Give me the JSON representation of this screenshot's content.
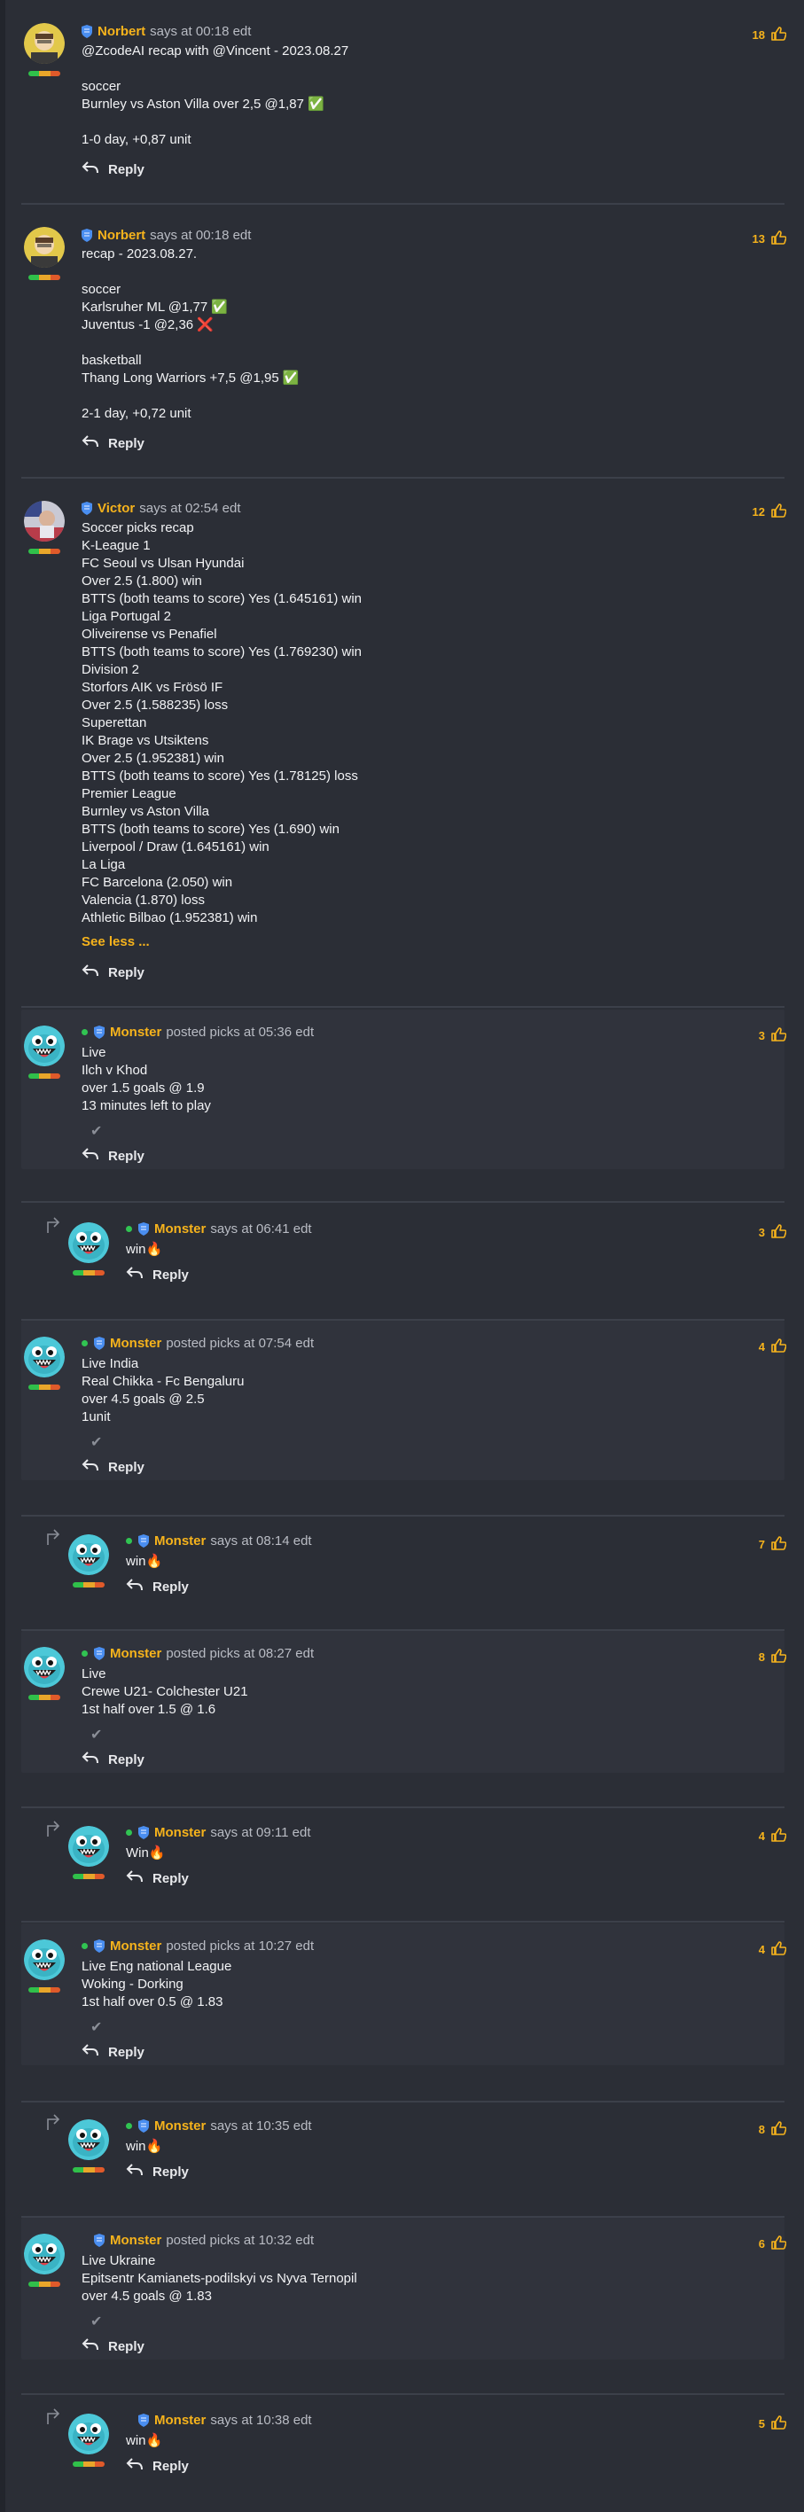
{
  "ui": {
    "says_at": "says at",
    "posted_picks_at": "posted picks at",
    "reply_label": "Reply",
    "see_less": "See less ..."
  },
  "colors": {
    "background": "#2b2e36",
    "accent": "#f6b31c",
    "online": "#31c452",
    "badge": "#4a8ef0",
    "separator": "#3c404a"
  },
  "posts": [
    {
      "author": "Norbert",
      "time": "00:18 edt",
      "likes": "18",
      "avatar": "avatar-norbert",
      "body": "@ZcodeAI recap with @Vincent - 2023.08.27\n\nsoccer\nBurnley vs Aston Villa over 2,5 @1,87 ✅\n\n1-0 day, +0,87 unit"
    },
    {
      "author": "Norbert",
      "time": "00:18 edt",
      "likes": "13",
      "avatar": "avatar-norbert",
      "body": "recap - 2023.08.27.\n\nsoccer\nKarlsruher ML @1,77 ✅\nJuventus -1 @2,36 ❌\n\nbasketball\nThang Long Warriors +7,5 @1,95 ✅\n\n2-1 day, +0,72 unit"
    },
    {
      "author": "Victor",
      "time": "02:54 edt",
      "likes": "12",
      "avatar": "avatar-victor",
      "body": "Soccer picks recap\nK-League 1\nFC Seoul vs Ulsan Hyundai\nOver 2.5 (1.800) win\nBTTS (both teams to score) Yes (1.645161) win\nLiga Portugal 2\nOliveirense vs Penafiel\nBTTS (both teams to score) Yes (1.769230) win\nDivision 2\nStorfors AIK vs Frösö IF\nOver 2.5 (1.588235) loss\nSuperettan\nIK Brage vs Utsiktens\nOver 2.5 (1.952381) win\nBTTS (both teams to score) Yes (1.78125) loss\nPremier League\nBurnley vs Aston Villa\nBTTS (both teams to score) Yes (1.690) win\nLiverpool / Draw (1.645161) win\nLa Liga\nFC Barcelona (2.050) win\nValencia (1.870) loss\nAthletic Bilbao (1.952381) win"
    },
    {
      "author": "Monster",
      "time": "05:36 edt",
      "likes": "3",
      "type": "picks",
      "body": "Live\nIlch v Khod\nover 1.5 goals @ 1.9\n13 minutes left to play"
    },
    {
      "author": "Monster",
      "time": "06:41 edt",
      "likes": "3",
      "type": "reply",
      "body": "win🔥"
    },
    {
      "author": "Monster",
      "time": "07:54 edt",
      "likes": "4",
      "type": "picks",
      "body": "Live India\nReal Chikka - Fc Bengaluru\nover 4.5 goals @ 2.5\n1unit"
    },
    {
      "author": "Monster",
      "time": "08:14 edt",
      "likes": "7",
      "type": "reply",
      "body": "win🔥"
    },
    {
      "author": "Monster",
      "time": "08:27 edt",
      "likes": "8",
      "type": "picks",
      "body": "Live\nCrewe U21- Colchester U21\n1st half over 1.5 @ 1.6"
    },
    {
      "author": "Monster",
      "time": "09:11 edt",
      "likes": "4",
      "type": "reply",
      "body": "Win🔥"
    },
    {
      "author": "Monster",
      "time": "10:27 edt",
      "likes": "4",
      "type": "picks",
      "body": "Live Eng national League\nWoking - Dorking\n1st half over 0.5 @ 1.83"
    },
    {
      "author": "Monster",
      "time": "10:35 edt",
      "likes": "8",
      "type": "reply",
      "body": "win🔥"
    },
    {
      "author": "Monster",
      "time": "10:32 edt",
      "likes": "6",
      "type": "picks",
      "body": "Live Ukraine\nEpitsentr Kamianets-podilskyi vs Nyva Ternopil\nover 4.5 goals @ 1.83"
    },
    {
      "author": "Monster",
      "time": "10:38 edt",
      "likes": "5",
      "type": "reply",
      "body": "win🔥"
    }
  ]
}
